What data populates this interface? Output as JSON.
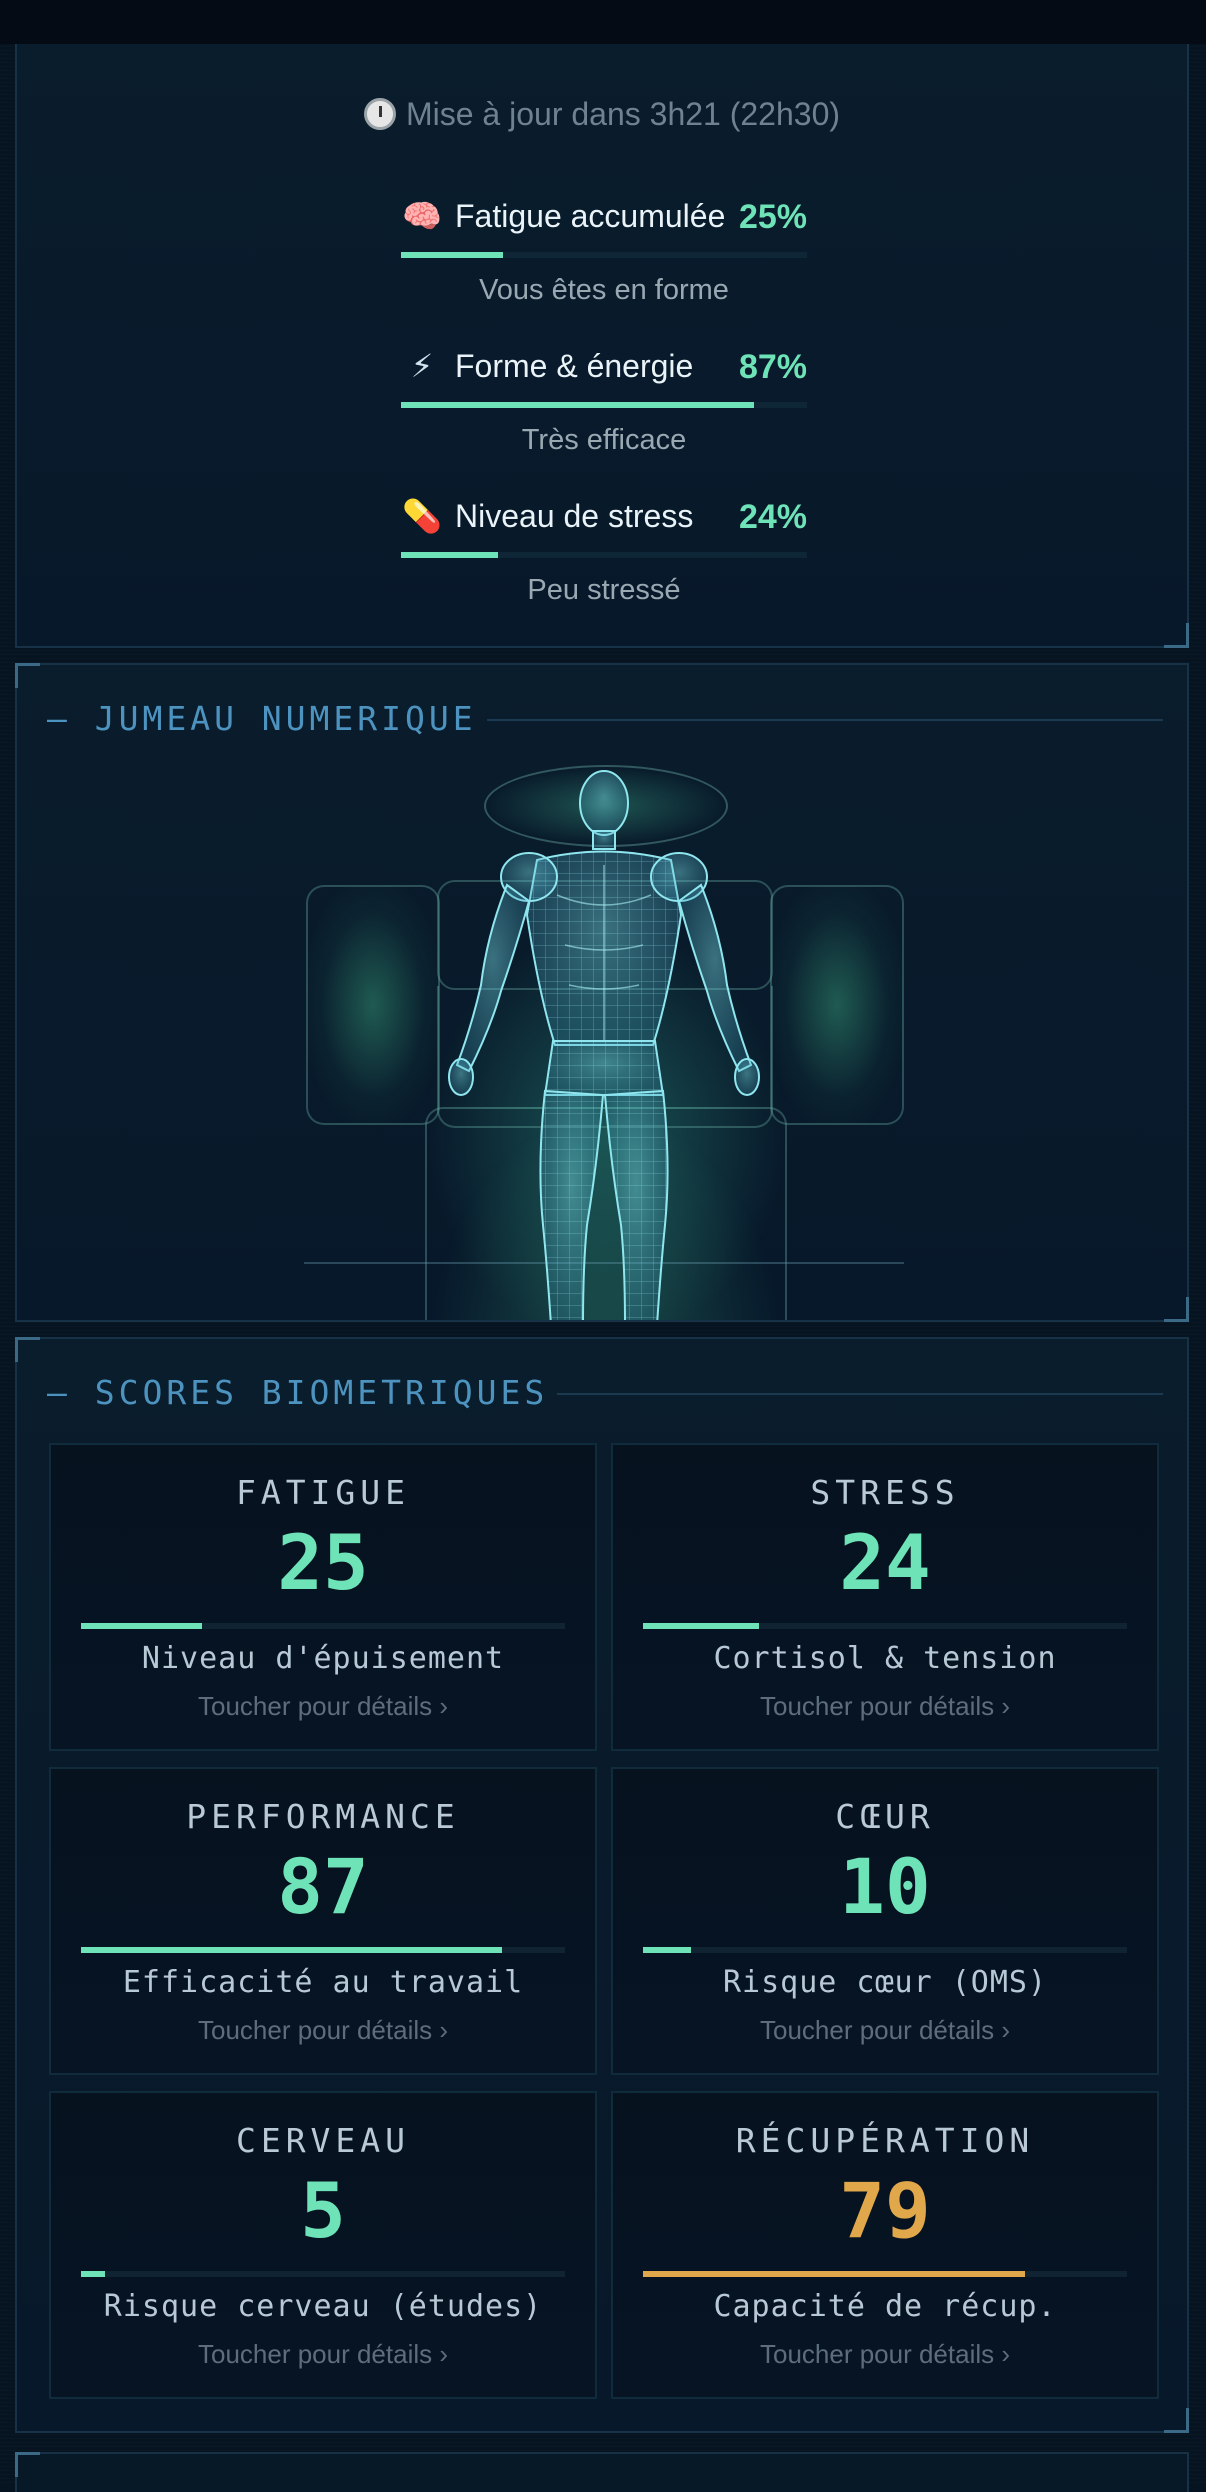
{
  "header": {
    "update_text": "Mise à jour dans 3h21 (22h30)"
  },
  "summary_metrics": [
    {
      "emoji": "🧠",
      "label": "Fatigue accumulée",
      "percent": "25%",
      "value": 25,
      "sub": "Vous êtes en forme"
    },
    {
      "emoji": "⚡",
      "label": "Forme & énergie",
      "percent": "87%",
      "value": 87,
      "sub": "Très efficace"
    },
    {
      "emoji": "💊",
      "label": "Niveau de stress",
      "percent": "24%",
      "value": 24,
      "sub": "Peu stressé"
    }
  ],
  "digital_twin": {
    "title": "– JUMEAU NUMERIQUE"
  },
  "biometrics": {
    "title": "– SCORES BIOMETRIQUES",
    "cards": [
      {
        "title": "FATIGUE",
        "value": "25",
        "score": 25,
        "sub": "Niveau d'épuisement",
        "hint": "Toucher pour détails ›",
        "color": "#6fe3b8"
      },
      {
        "title": "STRESS",
        "value": "24",
        "score": 24,
        "sub": "Cortisol & tension",
        "hint": "Toucher pour détails ›",
        "color": "#6fe3b8"
      },
      {
        "title": "PERFORMANCE",
        "value": "87",
        "score": 87,
        "sub": "Efficacité au travail",
        "hint": "Toucher pour détails ›",
        "color": "#6fe3b8"
      },
      {
        "title": "CŒUR",
        "value": "10",
        "score": 10,
        "sub": "Risque cœur (OMS)",
        "hint": "Toucher pour détails ›",
        "color": "#6fe3b8"
      },
      {
        "title": "CERVEAU",
        "value": "5",
        "score": 5,
        "sub": "Risque cerveau (études)",
        "hint": "Toucher pour détails ›",
        "color": "#6fe3b8"
      },
      {
        "title": "RÉCUPÉRATION",
        "value": "79",
        "score": 79,
        "sub": "Capacité de récup.",
        "hint": "Toucher pour détails ›",
        "color": "#e0a84a"
      }
    ]
  }
}
